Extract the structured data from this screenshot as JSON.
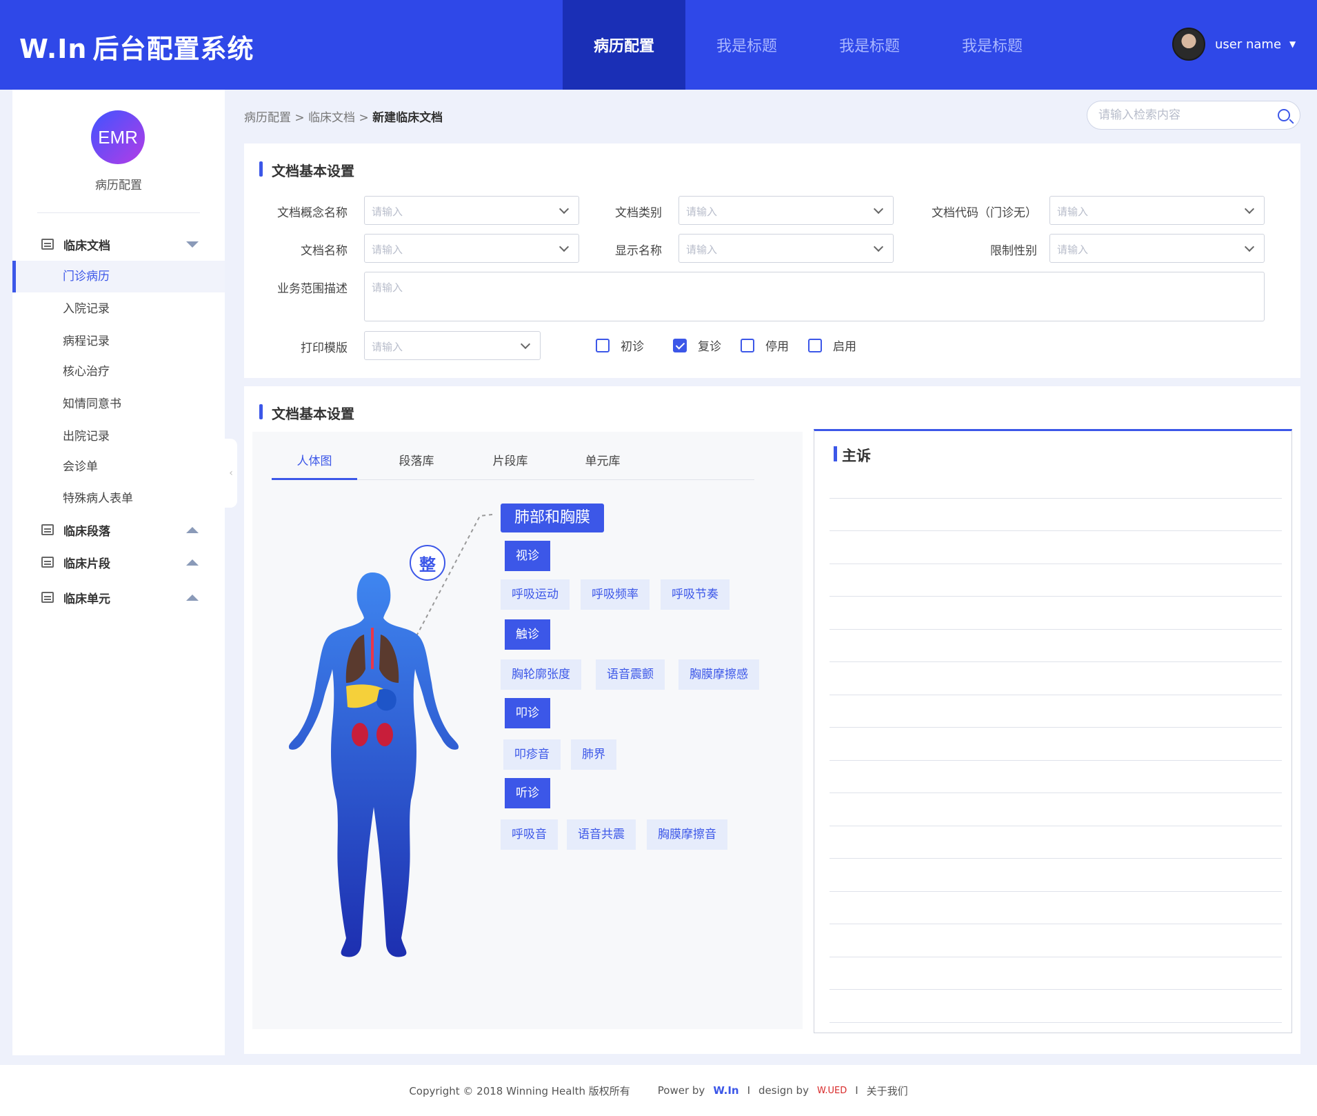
{
  "header": {
    "brand": "W.In",
    "title": "后台配置系统",
    "nav": [
      {
        "label": "病历配置",
        "active": true
      },
      {
        "label": "我是标题",
        "active": false
      },
      {
        "label": "我是标题",
        "active": false
      },
      {
        "label": "我是标题",
        "active": false
      }
    ],
    "user_name": "user name"
  },
  "sidebar": {
    "logo_text": "EMR",
    "title": "病历配置",
    "groups": [
      {
        "label": "临床文档",
        "expanded": true,
        "items": [
          "门诊病历",
          "入院记录",
          "病程记录",
          "核心治疗",
          "知情同意书",
          "出院记录",
          "会诊单",
          "特殊病人表单"
        ]
      },
      {
        "label": "临床段落",
        "expanded": false
      },
      {
        "label": "临床片段",
        "expanded": false
      },
      {
        "label": "临床单元",
        "expanded": false
      }
    ],
    "active_item": "门诊病历"
  },
  "breadcrumb": {
    "items": [
      "病历配置",
      "临床文档"
    ],
    "separator": ">",
    "current": "新建临床文档"
  },
  "search": {
    "placeholder": "请输入检索内容"
  },
  "panel1": {
    "title": "文档基本设置",
    "fields": {
      "concept_name": {
        "label": "文档概念名称",
        "placeholder": "请输入"
      },
      "doc_type": {
        "label": "文档类别",
        "placeholder": "请输入"
      },
      "doc_code": {
        "label": "文档代码（门诊无）",
        "placeholder": "请输入"
      },
      "doc_name": {
        "label": "文档名称",
        "placeholder": "请输入"
      },
      "display_name": {
        "label": "显示名称",
        "placeholder": "请输入"
      },
      "gender_limit": {
        "label": "限制性别",
        "placeholder": "请输入"
      },
      "scope_desc": {
        "label": "业务范围描述",
        "placeholder": "请输入"
      },
      "print_template": {
        "label": "打印模版",
        "placeholder": "请输入"
      }
    },
    "checkboxes": [
      {
        "label": "初诊",
        "checked": false
      },
      {
        "label": "复诊",
        "checked": true
      },
      {
        "label": "停用",
        "checked": false
      },
      {
        "label": "启用",
        "checked": false
      }
    ]
  },
  "panel2": {
    "title": "文档基本设置",
    "tabs": [
      "人体图",
      "段落库",
      "片段库",
      "单元库"
    ],
    "active_tab": "人体图",
    "body_badge": "整",
    "section_title": "肺部和胸膜",
    "categories": [
      {
        "label": "视诊",
        "tags": [
          "呼吸运动",
          "呼吸频率",
          "呼吸节奏"
        ]
      },
      {
        "label": "触诊",
        "tags": [
          "胸轮廓张度",
          "语音震颤",
          "胸膜摩擦感"
        ]
      },
      {
        "label": "叩诊",
        "tags": [
          "叩疹音",
          "肺界"
        ]
      },
      {
        "label": "听诊",
        "tags": [
          "呼吸音",
          "语音共震",
          "胸膜摩擦音"
        ]
      }
    ],
    "right_title": "主诉",
    "accent": "#3c57e8"
  },
  "footer": {
    "copyright": "Copyright © 2018 Winning Health 版权所有",
    "power_by": "Power by",
    "power_logo": "W.In",
    "sep1": "I",
    "design_by": "design by",
    "design_logo": "W.UED",
    "sep2": "I",
    "about": "关于我们"
  }
}
